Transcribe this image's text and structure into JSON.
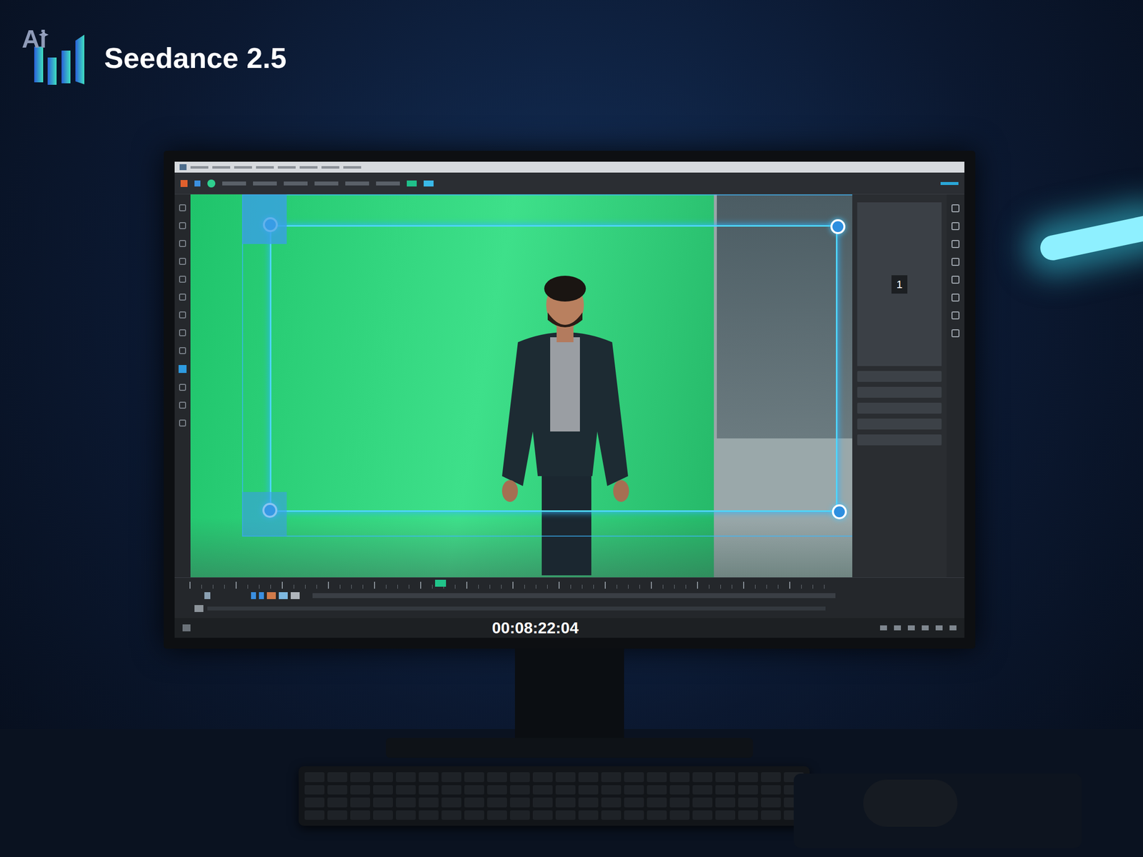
{
  "logo": {
    "badge": "Ai",
    "name": "Seedance 2.5"
  },
  "editor": {
    "timecode": "00:08:22:04",
    "preview_label": "1",
    "playhead": {
      "level": 0.33
    }
  }
}
